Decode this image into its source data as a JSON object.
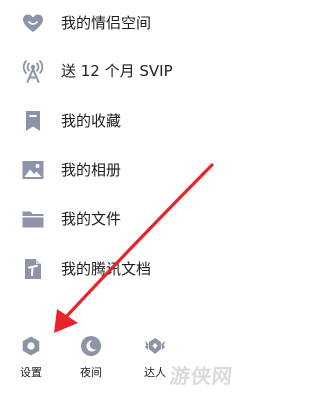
{
  "colors": {
    "icon": "#8f93a8",
    "arrow": "#e8232a",
    "text": "#1f1f1f"
  },
  "menu": [
    {
      "label": "我的情侣空间",
      "icon": "heart-icon"
    },
    {
      "label": "送 12 个月 SVIP",
      "icon": "broadcast-tower-icon"
    },
    {
      "label": "我的收藏",
      "icon": "bookmark-icon"
    },
    {
      "label": "我的相册",
      "icon": "image-icon"
    },
    {
      "label": "我的文件",
      "icon": "folder-icon"
    },
    {
      "label": "我的腾讯文档",
      "icon": "document-icon"
    }
  ],
  "bottom_bar": [
    {
      "label": "设置",
      "icon": "gear-icon"
    },
    {
      "label": "夜间",
      "icon": "moon-icon"
    },
    {
      "label": "达人",
      "icon": "winged-badge-icon"
    }
  ],
  "watermark": "游侠网"
}
